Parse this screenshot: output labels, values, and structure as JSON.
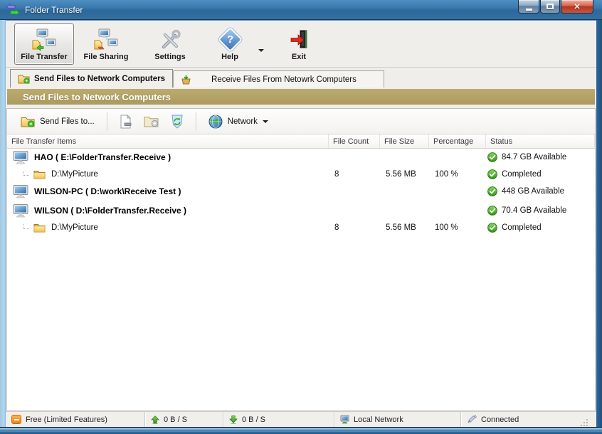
{
  "window": {
    "title": "Folder Transfer"
  },
  "toolbar": {
    "items": [
      {
        "label": "File Transfer",
        "selected": true
      },
      {
        "label": "File Sharing",
        "selected": false
      },
      {
        "label": "Settings",
        "selected": false
      },
      {
        "label": "Help",
        "selected": false
      },
      {
        "label": "Exit",
        "selected": false
      }
    ]
  },
  "tabs": [
    {
      "label": "Send Files to Network Computers",
      "active": true
    },
    {
      "label": "Receive Files From Netowrk Computers",
      "active": false
    }
  ],
  "section_header": "Send Files to Network Computers",
  "subtoolbar": {
    "send_files_label": "Send Files to...",
    "network_label": "Network"
  },
  "table": {
    "columns": [
      "File Transfer Items",
      "File Count",
      "File Size",
      "Percentage",
      "Status"
    ],
    "rows": [
      {
        "type": "computer",
        "name": "HAO ( E:\\FolderTransfer.Receive )",
        "file_count": "",
        "file_size": "",
        "percentage": "",
        "status": "84.7 GB Available"
      },
      {
        "type": "folder",
        "name": "D:\\MyPicture",
        "file_count": "8",
        "file_size": "5.56 MB",
        "percentage": "100 %",
        "status": "Completed"
      },
      {
        "type": "computer",
        "name": "WILSON-PC ( D:\\work\\Receive Test )",
        "file_count": "",
        "file_size": "",
        "percentage": "",
        "status": "448 GB Available"
      },
      {
        "type": "computer",
        "name": "WILSON ( D:\\FolderTransfer.Receive )",
        "file_count": "",
        "file_size": "",
        "percentage": "",
        "status": "70.4 GB Available"
      },
      {
        "type": "folder",
        "name": "D:\\MyPicture",
        "file_count": "8",
        "file_size": "5.56 MB",
        "percentage": "100 %",
        "status": "Completed"
      }
    ]
  },
  "statusbar": {
    "license": "Free (Limited Features)",
    "upload_speed": "0 B / S",
    "download_speed": "0 B / S",
    "network": "Local Network",
    "connection": "Connected"
  },
  "icons": {
    "app": "transfer-arrows",
    "tab_send": "folder-send",
    "tab_receive": "inbox-down-arrow",
    "status_ok": "green-check-circle",
    "license": "orange-limited-badge",
    "upload": "green-up-arrow",
    "download": "green-down-arrow",
    "network": "mini-computer",
    "connection": "plug"
  },
  "colors": {
    "titlebar_blue": "#2c689c",
    "frame_left_blue": "#9fc8e3",
    "frame_right_blue": "#2e689c",
    "gold_header": "#b2a163",
    "status_green": "#3ba428",
    "close_red": "#b03722",
    "folder_yellow": "#f2c24e",
    "toolbar_bg": "#f0eeeb"
  }
}
